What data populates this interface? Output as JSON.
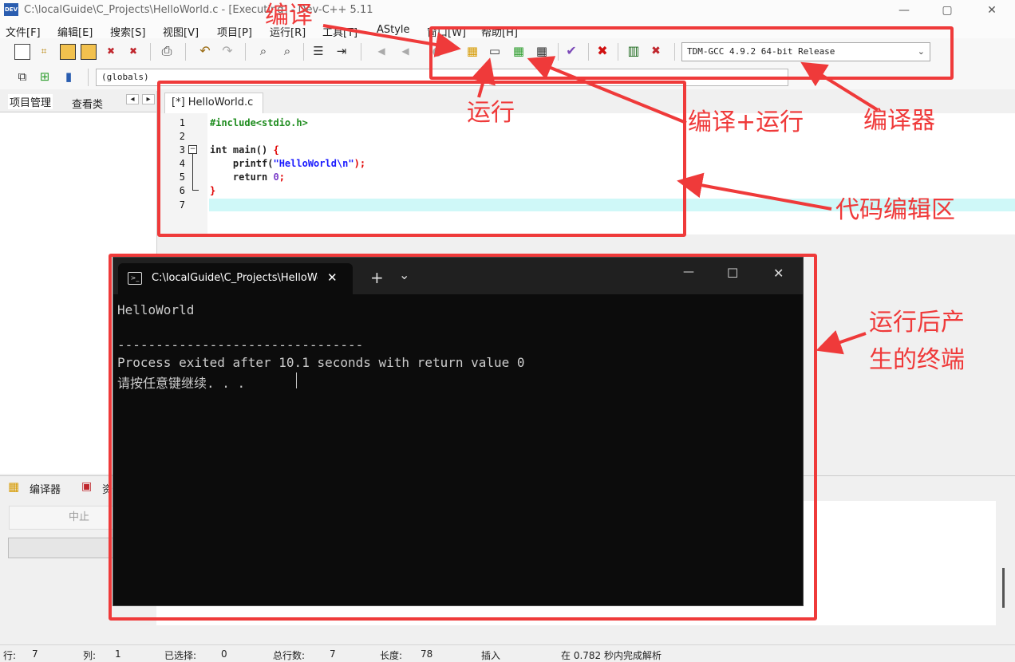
{
  "window": {
    "title": "C:\\localGuide\\C_Projects\\HelloWorld.c - [Executing] - Dev-C++ 5.11",
    "icon_label": "DEV",
    "minimize_glyph": "—",
    "maximize_glyph": "▢",
    "close_glyph": "✕"
  },
  "menu": [
    "文件[F]",
    "编辑[E]",
    "搜索[S]",
    "视图[V]",
    "项目[P]",
    "运行[R]",
    "工具[T]",
    "AStyle",
    "窗口[W]",
    "帮助[H]"
  ],
  "toolbar": {
    "compiler_select": "TDM-GCC 4.9.2 64-bit Release",
    "globals_select": "(globals)"
  },
  "left_panel": {
    "tabs": [
      "项目管理",
      "查看类"
    ],
    "nav_prev": "◂",
    "nav_next": "▸"
  },
  "editor": {
    "tab_label": "[*] HelloWorld.c",
    "line_numbers": [
      "1",
      "2",
      "3",
      "4",
      "5",
      "6",
      "7"
    ],
    "fold_marker": "−",
    "code": {
      "line1": "#include<stdio.h>",
      "line3_kw": "int main()",
      "line3_brace": " {",
      "line4_fn": "    printf(",
      "line4_str": "\"HelloWorld\\n\"",
      "line4_end": ");",
      "line5_kw": "    return ",
      "line5_num": "0",
      "line5_end": ";",
      "line6": "}"
    }
  },
  "bottom_panel": {
    "tabs": [
      "编译器",
      "资"
    ],
    "abort_button": "中止"
  },
  "statusbar": {
    "row_label": "行:",
    "row_value": "7",
    "col_label": "列:",
    "col_value": "1",
    "sel_label": "已选择:",
    "sel_value": "0",
    "total_label": "总行数:",
    "total_value": "7",
    "len_label": "长度:",
    "len_value": "78",
    "mode": "插入",
    "parse_msg": "在 0.782 秒内完成解析"
  },
  "terminal": {
    "tab_title": "C:\\localGuide\\C_Projects\\HelloWorld.exe",
    "tab_close": "✕",
    "new_tab": "+",
    "dropdown": "⌄",
    "minimize": "—",
    "maximize": "☐",
    "close": "✕",
    "output": [
      "HelloWorld",
      "",
      "--------------------------------",
      "Process exited after 10.1 seconds with return value 0",
      "请按任意键继续. . . "
    ]
  },
  "annotations": {
    "compile": "编译",
    "run": "运行",
    "compile_run": "编译+运行",
    "compiler": "编译器",
    "code_area": "代码编辑区",
    "terminal_line1": "运行后产",
    "terminal_line2": "生的终端"
  },
  "colors": {
    "annotation_red": "#ef3a3a",
    "current_line": "#cff8f8",
    "preprocessor_green": "#1e8c1e",
    "string_blue": "#1a1aff",
    "brace_red": "#e00000",
    "terminal_bg": "#0c0c0c"
  }
}
